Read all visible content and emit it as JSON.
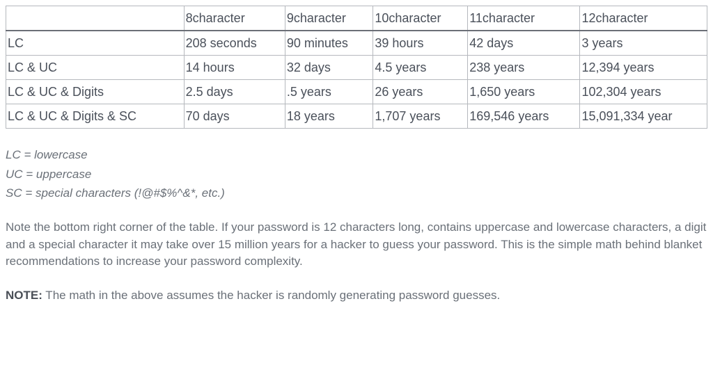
{
  "table": {
    "headers": [
      "",
      "8character",
      "9character",
      "10character",
      "11character",
      "12character"
    ],
    "rows": [
      {
        "label": "LC",
        "cells": [
          "208 seconds",
          "90 minutes",
          "39 hours",
          "42 days",
          "3 years"
        ]
      },
      {
        "label": "LC & UC",
        "cells": [
          "14 hours",
          "32 days",
          "4.5 years",
          "238 years",
          "12,394 years"
        ]
      },
      {
        "label": "LC & UC & Digits",
        "cells": [
          "2.5 days",
          ".5 years",
          "26 years",
          "1,650 years",
          "102,304 years"
        ]
      },
      {
        "label": "LC & UC & Digits & SC",
        "cells": [
          "70 days",
          "18 years",
          "1,707 years",
          "169,546 years",
          "15,091,334 year"
        ]
      }
    ]
  },
  "legend": {
    "lc": "LC = lowercase",
    "uc": "UC = uppercase",
    "sc": "SC = special characters (!@#$%^&*, etc.)"
  },
  "note_para": "Note the bottom right corner of the table. If your password is 12 characters long, contains uppercase and lowercase characters, a digit and a special character it may take over 15 million years for a hacker to guess your password. This is the simple math behind blanket recommendations to increase your password complexity.",
  "note_label": "NOTE:",
  "note_text": " The math in the above assumes the hacker is randomly generating password guesses."
}
